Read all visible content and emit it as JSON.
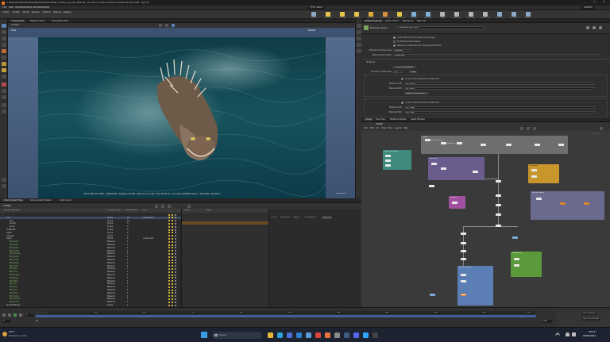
{
  "window": {
    "title": "C:/Users/Kostas/Desktop/KOSTAS/CROC/CROC_Solaris_Layout_v004.hip - Houdini FX Indie Limited-Commercial 20.0.590 - Py3.11",
    "minimize": "–",
    "maximize": "▢",
    "close": "✕"
  },
  "menu": [
    "File",
    "Edit",
    "Render",
    "Assets",
    "Windows",
    "Help"
  ],
  "shelf": {
    "set": "Pyro Tools",
    "tabs": [
      "Create",
      "Modify",
      "Model",
      "Polygon",
      "Deform",
      "Texture",
      "Rigging"
    ],
    "tools": [
      "Camera",
      "Point Light",
      "Spot Light",
      "Area Light",
      "Geo Light",
      "Volume Light",
      "Distant Light",
      "Env Light",
      "Sky Light",
      "GI Light",
      "Caustic Light",
      "Portal Light",
      "Ambient Light",
      "Stereo Cam",
      "VR Camera",
      "Switcher"
    ],
    "toggle_label": "Solaris"
  },
  "viewport": {
    "tabs": [
      "Scene View",
      "Network View",
      "Composite View"
    ],
    "context": "/stage",
    "camera": "Free",
    "render_label": "Karma",
    "status_line": "Karma XPU 20.0.590 · 1920x1080 · Samples 12/128 · Memory 4.21 GB · Time 00:00:14 · Crocodile_CLOSEUP_Seq_A · Renderer: karmaxpu",
    "corner_text": "Karma XPU"
  },
  "scenegraph": {
    "tabs": [
      "Scene Graph Tree",
      "Scene Graph Details",
      "Light Linker"
    ],
    "context": "/stage",
    "columns": [
      "Scene Graph Path",
      "Primitive Type",
      "Descendants",
      "Kind"
    ],
    "rows": [
      {
        "name": "/",
        "type": "",
        "count": "",
        "kind": "",
        "depth": 0,
        "color": "#c9c9c9"
      },
      {
        "name": "croc",
        "type": "Xform",
        "count": "12",
        "kind": "component",
        "depth": 1,
        "color": "#c9c9c9"
      },
      {
        "name": "geo",
        "type": "Scope",
        "count": "10",
        "kind": "",
        "depth": 2,
        "color": "#c9c9c9"
      },
      {
        "name": "render",
        "type": "Scope",
        "count": "3",
        "kind": "",
        "depth": 2,
        "color": "#c9c9c9"
      },
      {
        "name": "proxy",
        "type": "Scope",
        "count": "3",
        "kind": "",
        "depth": 2,
        "color": "#c9c9c9"
      },
      {
        "name": "materials",
        "type": "Scope",
        "count": "8",
        "kind": "",
        "depth": 1,
        "color": "#c9c9c9"
      },
      {
        "name": "lights",
        "type": "Scope",
        "count": "2",
        "kind": "",
        "depth": 1,
        "color": "#c9c9c9"
      },
      {
        "name": "cameras",
        "type": "Scope",
        "count": "1",
        "kind": "",
        "depth": 1,
        "color": "#c9c9c9"
      },
      {
        "name": "water",
        "type": "Xform",
        "count": "4",
        "kind": "component",
        "depth": 1,
        "color": "#c9c9c9"
      },
      {
        "name": "Mtl_Body",
        "type": "Material",
        "count": "1",
        "kind": "",
        "depth": 2,
        "color": "#7fbf5f"
      },
      {
        "name": "Mtl_Eyes",
        "type": "Material",
        "count": "1",
        "kind": "",
        "depth": 2,
        "color": "#7fbf5f"
      },
      {
        "name": "Mtl_Teeth",
        "type": "Material",
        "count": "1",
        "kind": "",
        "depth": 2,
        "color": "#7fbf5f"
      },
      {
        "name": "Mtl_Spikes",
        "type": "Material",
        "count": "1",
        "kind": "",
        "depth": 2,
        "color": "#7fbf5f"
      },
      {
        "name": "Mtl_Tongue",
        "type": "Material",
        "count": "1",
        "kind": "",
        "depth": 2,
        "color": "#7fbf5f"
      },
      {
        "name": "Mtl_Gums",
        "type": "Material",
        "count": "1",
        "kind": "",
        "depth": 2,
        "color": "#7fbf5f"
      },
      {
        "name": "Mtl_Claws",
        "type": "Material",
        "count": "1",
        "kind": "",
        "depth": 2,
        "color": "#7fbf5f"
      },
      {
        "name": "Mtl_Water",
        "type": "Material",
        "count": "1",
        "kind": "",
        "depth": 2,
        "color": "#7fbf5f"
      },
      {
        "name": "Mtl_Foam",
        "type": "Material",
        "count": "1",
        "kind": "",
        "depth": 2,
        "color": "#7fbf5f"
      },
      {
        "name": "Mtl_Wet",
        "type": "Material",
        "count": "1",
        "kind": "",
        "depth": 2,
        "color": "#7fbf5f"
      },
      {
        "name": "Mtl_Skin",
        "type": "Material",
        "count": "1",
        "kind": "",
        "depth": 2,
        "color": "#7fbf5f"
      },
      {
        "name": "Mtl_Scales",
        "type": "Material",
        "count": "1",
        "kind": "",
        "depth": 2,
        "color": "#7fbf5f"
      },
      {
        "name": "Mtl_Belly",
        "type": "Material",
        "count": "1",
        "kind": "",
        "depth": 2,
        "color": "#7fbf5f"
      },
      {
        "name": "Mtl_Nails",
        "type": "Material",
        "count": "1",
        "kind": "",
        "depth": 2,
        "color": "#7fbf5f"
      },
      {
        "name": "Mtl_Iris",
        "type": "Material",
        "count": "1",
        "kind": "",
        "depth": 2,
        "color": "#7fbf5f"
      },
      {
        "name": "Mtl_Lids",
        "type": "Material",
        "count": "1",
        "kind": "",
        "depth": 2,
        "color": "#7fbf5f"
      },
      {
        "name": "Mtl_Env",
        "type": "Material",
        "count": "1",
        "kind": "",
        "depth": 2,
        "color": "#7fbf5f"
      },
      {
        "name": "Mtl_Drips",
        "type": "Material",
        "count": "1",
        "kind": "",
        "depth": 2,
        "color": "#7fbf5f"
      },
      {
        "name": "Mtl_Spray",
        "type": "Material",
        "count": "1",
        "kind": "",
        "depth": 2,
        "color": "#7fbf5f"
      },
      {
        "name": "Mtl_Ground",
        "type": "Material",
        "count": "1",
        "kind": "",
        "depth": 2,
        "color": "#7fbf5f"
      },
      {
        "name": "Mtl_Rocks",
        "type": "Material",
        "count": "1",
        "kind": "",
        "depth": 2,
        "color": "#7fbf5f"
      },
      {
        "name": "rendersettings",
        "type": "Scope",
        "count": "2",
        "kind": "",
        "depth": 1,
        "color": "#c9c9c9"
      }
    ],
    "props_header": [
      "Name",
      "Value"
    ],
    "detail_tabs": [
      "Prims",
      "Attributes",
      "Layers",
      "Composition",
      "Materials"
    ]
  },
  "params": {
    "tabs": [
      "Material Library",
      "Scene Import",
      "Reference",
      "Take List"
    ],
    "node_type": "Material Library",
    "node_name": "materiallibrary_CROC",
    "top_rows": [
      {
        "label": "",
        "check": true,
        "text": "Load Materials from Referenced Stage"
      },
      {
        "label": "",
        "check": false,
        "text": "Fill Material Parameters"
      },
      {
        "label": "",
        "check": true,
        "text": "Reference Materials Into Assigned Primitives"
      }
    ],
    "fields": [
      {
        "label": "Material Primitive Type",
        "value": "Material"
      },
      {
        "label": "Material Path Prefix",
        "value": "/materials/"
      }
    ],
    "section_label": "Materials",
    "count_label": "Number of Materials",
    "count_value": "23",
    "clear_label": "Clear",
    "fill_label": "Auto-Fill Materials",
    "entries": [
      {
        "toggle_label": "Include Only Referenced Materials",
        "vop_label": "Material VOP",
        "vop_value": "Mtl_Body",
        "path_label": "Material Path",
        "path_value": "Mtl_Body",
        "assign_label": "Assign to Geometry"
      },
      {
        "toggle_label": "Include Only Referenced Materials",
        "vop_label": "Material VOP",
        "vop_value": "Mtl_Eyes",
        "path_label": "Material Path",
        "path_value": "Mtl_Eyes",
        "assign_label": ""
      }
    ]
  },
  "network": {
    "tabs": [
      "/stage",
      "Tree View",
      "Material Palette",
      "Asset Browser"
    ],
    "path": "stage",
    "menu": [
      "Add",
      "Edit",
      "Go",
      "View",
      "Tools",
      "Layout",
      "Help"
    ],
    "context_tag": "Solaris",
    "nodes_top": [
      "sopimport_croc",
      "sopimport_water",
      "sopimport_eyes",
      "sopimport_teeth",
      "sopimport_spikes",
      "sopimport_env",
      "sopimport_ground"
    ],
    "box_titles": [
      "Import",
      "CROC geometry",
      "Lighting",
      "Materials",
      "Render Setup",
      "Karma output",
      "Camera",
      "Assignment"
    ]
  },
  "timeline": {
    "frame": "1",
    "start": "1",
    "end": "240",
    "ticks": [
      "1",
      "24",
      "48",
      "72",
      "96",
      "120",
      "144",
      "168",
      "192",
      "216",
      "240"
    ],
    "fps_label": "24",
    "auto_update": "Auto Update",
    "keys_label": "Key All Channels"
  },
  "taskbar": {
    "weather_temp": "19°C",
    "weather_desc": "Prevalent. nuvoló",
    "search_placeholder": "Cerca",
    "time": "18:14",
    "date": "05/05/2024",
    "apps": [
      "file-explorer",
      "edge",
      "store",
      "mail",
      "photos",
      "chrome",
      "houdini",
      "settings",
      "steam",
      "discord",
      "photoshop",
      "terminal"
    ]
  },
  "colors": {
    "accent": "#3f6db3",
    "teal_box": "#3f8a7e",
    "purple_box": "#6a5d8e",
    "orange_box": "#c8962b",
    "green_box": "#5a9a3b",
    "blue_box": "#5b7fb4",
    "magenta_box": "#a052a0"
  }
}
